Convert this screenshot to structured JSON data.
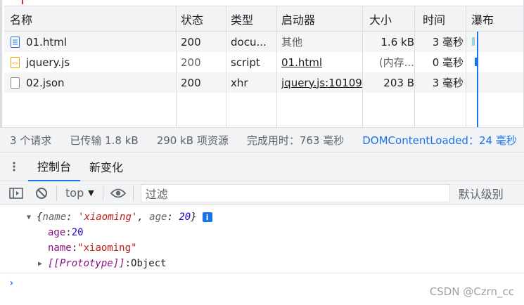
{
  "network": {
    "columns": {
      "name": "名称",
      "status": "状态",
      "type": "类型",
      "initiator": "启动器",
      "size": "大小",
      "time": "时间",
      "waterfall": "瀑布"
    },
    "rows": [
      {
        "name": "01.html",
        "icon": "document-icon",
        "status": "200",
        "type": "docu...",
        "initiator": "其他",
        "size": "1.6 kB",
        "time": "3 毫秒"
      },
      {
        "name": "jquery.js",
        "icon": "script-icon",
        "status": "200",
        "type": "script",
        "initiator": "01.html",
        "size": "(内存...",
        "time": "0 毫秒"
      },
      {
        "name": "02.json",
        "icon": "blank-file-icon",
        "status": "200",
        "type": "xhr",
        "initiator": "jquery.js:10109",
        "size": "203 B",
        "time": "3 毫秒"
      }
    ]
  },
  "summary": {
    "requests": "3 个请求",
    "transferred": "已传输 1.8 kB",
    "resources": "290 kB 项资源",
    "finish": "完成用时：763 毫秒",
    "dcl": "DOMContentLoaded：24 毫秒"
  },
  "drawer": {
    "tabs": [
      "控制台",
      "新变化"
    ]
  },
  "console_toolbar": {
    "context": "top",
    "filter_placeholder": "过滤",
    "levels": "默认级别"
  },
  "console": {
    "object_preview": {
      "open": "{",
      "k1": "name",
      "v1": "'xiaoming'",
      "sep": ", ",
      "k2": "age",
      "v2": "20",
      "close": "}"
    },
    "age_key": "age",
    "age_val": "20",
    "name_key": "name",
    "name_val": "\"xiaoming\"",
    "proto_key": "[[Prototype]]",
    "proto_val": "Object"
  },
  "watermark": "CSDN @Czrn_cc",
  "colors": {
    "accent": "#1a73e8",
    "string": "#c41a16",
    "key": "#881280",
    "number": "#1c00cf"
  }
}
